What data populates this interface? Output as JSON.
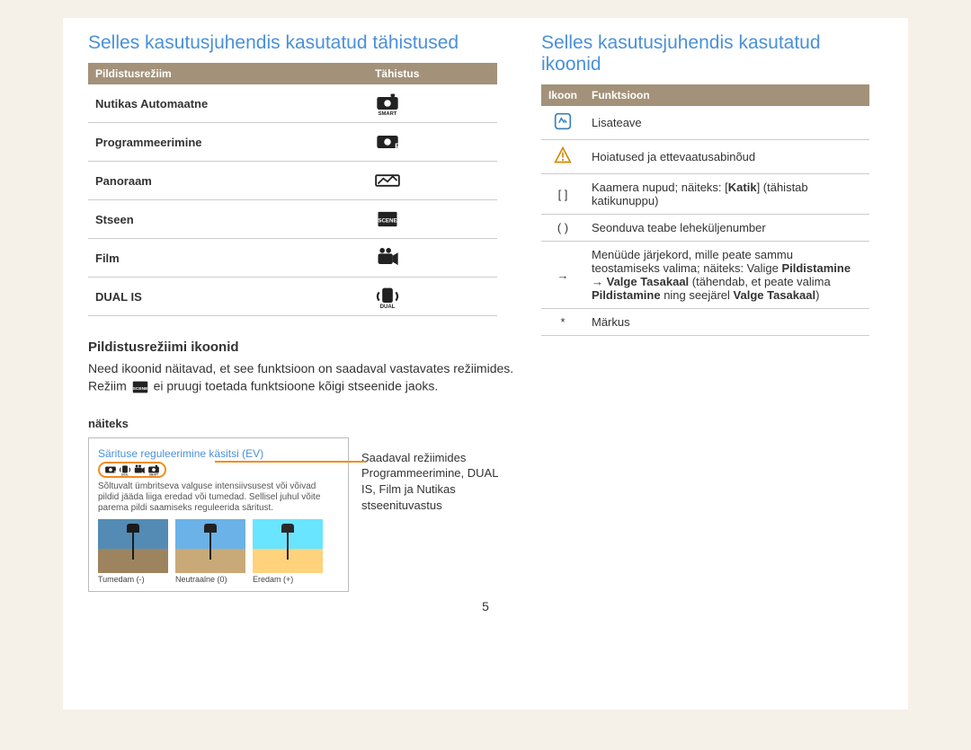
{
  "left": {
    "heading": "Selles kasutusjuhendis kasutatud tähistused",
    "table": {
      "head1": "Pildistusrežiim",
      "head2": "Tähistus",
      "rows": [
        {
          "label": "Nutikas Automaatne",
          "icon": "smart"
        },
        {
          "label": "Programmeerimine",
          "icon": "program"
        },
        {
          "label": "Panoraam",
          "icon": "panorama"
        },
        {
          "label": "Stseen",
          "icon": "scene"
        },
        {
          "label": "Film",
          "icon": "movie"
        },
        {
          "label": "DUAL IS",
          "icon": "dual"
        }
      ]
    },
    "subheading": "Pildistusrežiimi ikoonid",
    "body_pre": "Need ikoonid näitavad, et see funktsioon on saadaval vastavates režiimides. Režiim ",
    "body_post": " ei pruugi toetada funktsioone kõigi stseenide jaoks.",
    "example_label": "näiteks",
    "example": {
      "title": "Särituse reguleerimine käsitsi (EV)",
      "desc": "Sõltuvalt ümbritseva valguse intensiivsusest või võivad pildid jääda liiga eredad või tumedad. Sellisel juhul võite parema pildi saamiseks reguleerida säritust.",
      "thumbs": [
        {
          "cap": "Tumedam (-)"
        },
        {
          "cap": "Neutraalne (0)"
        },
        {
          "cap": "Eredam (+)"
        }
      ]
    },
    "side_note": "Saadaval režiimides Programmeerimine, DUAL IS, Film ja Nutikas stseenituvastus"
  },
  "right": {
    "heading": "Selles kasutusjuhendis kasutatud ikoonid",
    "table": {
      "head1": "Ikoon",
      "head2": "Funktsioon",
      "rows": [
        {
          "icon": "info",
          "text": "Lisateave"
        },
        {
          "icon": "warn",
          "text": "Hoiatused ja ettevaatusabinõud"
        },
        {
          "icon": "[ ]",
          "parts": [
            "Kaamera nupud; näiteks: [",
            "Katik",
            "] (tähistab katikunuppu)"
          ]
        },
        {
          "icon": "( )",
          "text": "Seonduva teabe leheküljenumber"
        },
        {
          "icon": "→",
          "parts": [
            "Menüüde järjekord, mille peate sammu teostamiseks valima; näiteks: Valige ",
            "Pildistamine",
            " → ",
            "Valge Tasakaal",
            " (tähendab, et peate valima ",
            "Pildistamine",
            " ning seejärel ",
            "Valge Tasakaal",
            ")"
          ]
        },
        {
          "icon": "*",
          "text": "Märkus"
        }
      ]
    }
  },
  "page_number": "5"
}
